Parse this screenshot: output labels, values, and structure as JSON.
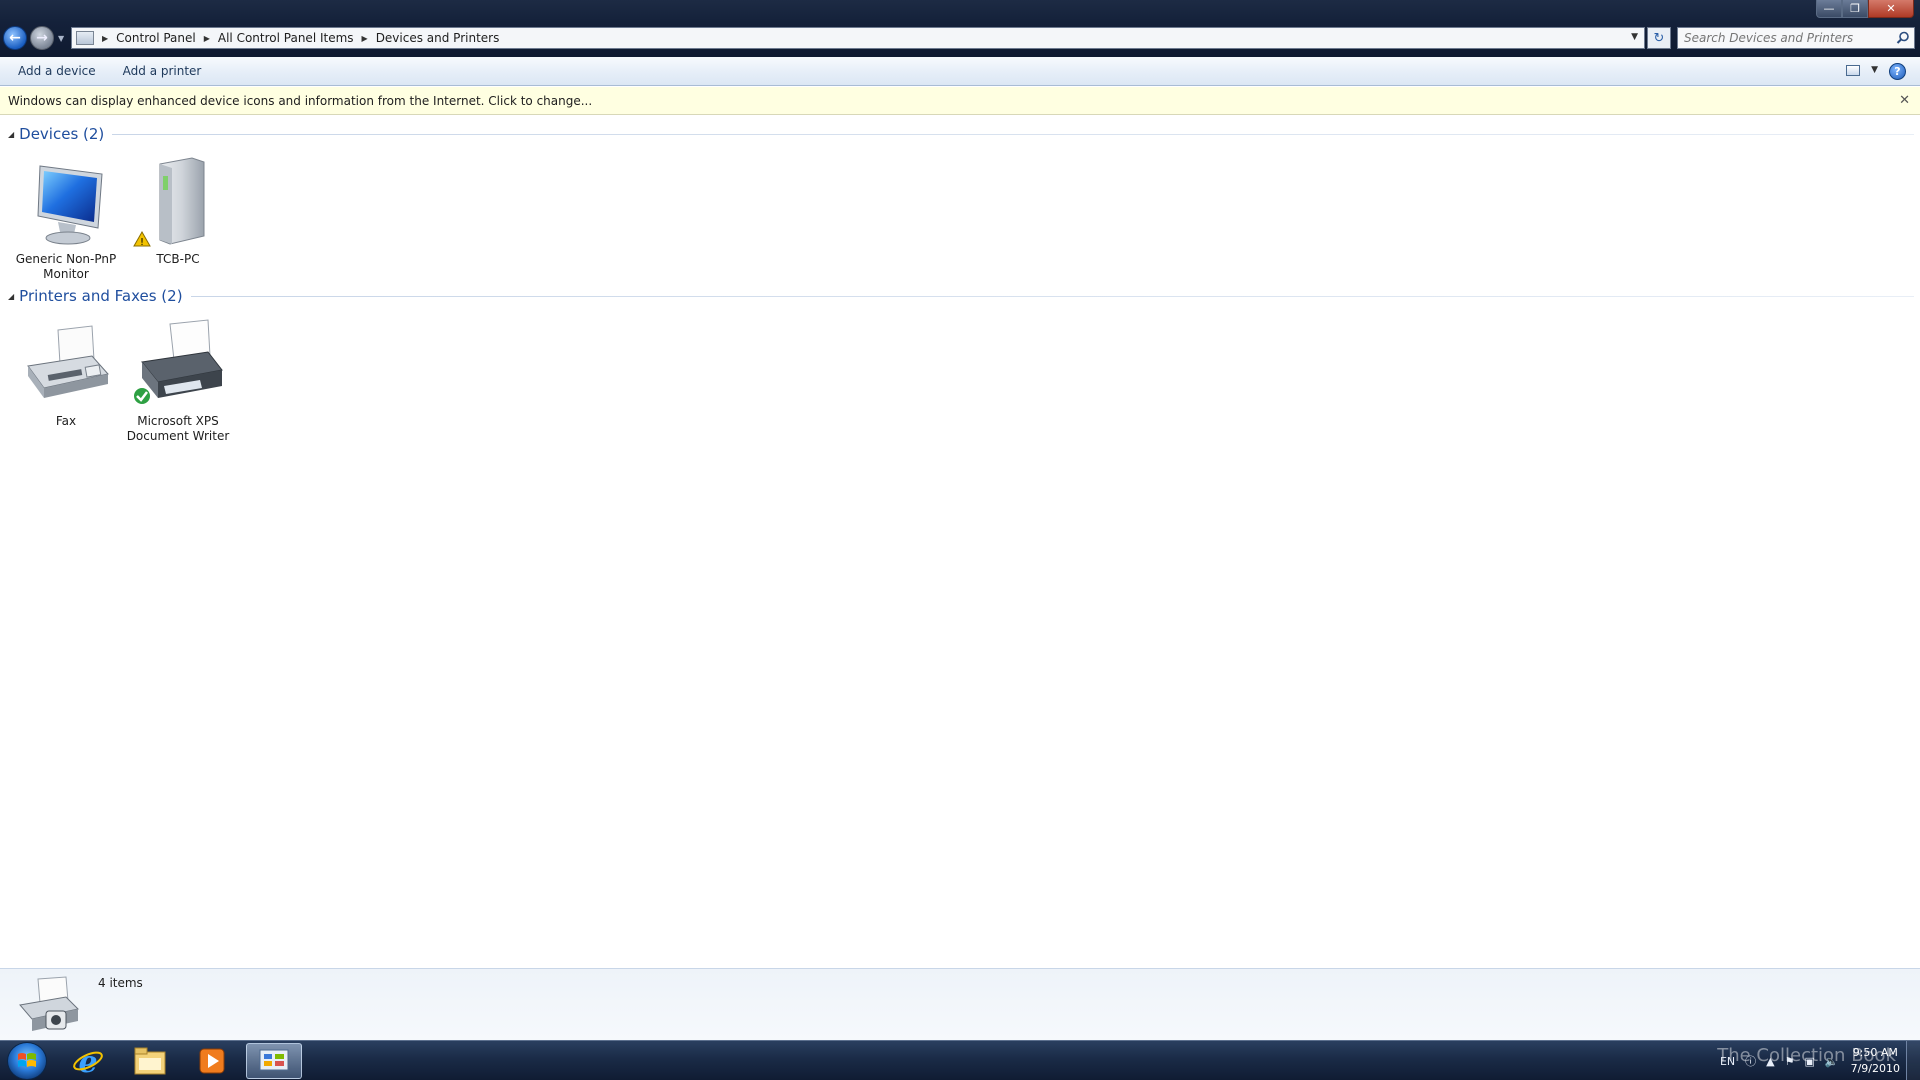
{
  "window": {
    "controls": [
      "minimize",
      "maximize",
      "close"
    ]
  },
  "address": {
    "crumbs": [
      "Control Panel",
      "All Control Panel Items",
      "Devices and Printers"
    ]
  },
  "search": {
    "placeholder": "Search Devices and Printers"
  },
  "toolbar": {
    "add_device_label": "Add a device",
    "add_printer_label": "Add a printer"
  },
  "infobar": {
    "text": "Windows can display enhanced device icons and information from the Internet. Click to change..."
  },
  "groups": [
    {
      "title": "Devices (2)",
      "items": [
        {
          "label_lines": [
            "Generic Non-PnP",
            "Monitor"
          ],
          "icon": "monitor-icon"
        },
        {
          "label_lines": [
            "TCB-PC"
          ],
          "icon": "computer-tower-icon",
          "badge": "warning"
        }
      ]
    },
    {
      "title": "Printers and Faxes (2)",
      "items": [
        {
          "label_lines": [
            "Fax"
          ],
          "icon": "fax-icon"
        },
        {
          "label_lines": [
            "Microsoft XPS",
            "Document Writer"
          ],
          "icon": "printer-icon",
          "badge": "default-check"
        }
      ]
    }
  ],
  "details": {
    "count": "4 items",
    "icon": "devices-printers-icon"
  },
  "taskbar": {
    "items": [
      "internet-explorer-icon",
      "windows-explorer-icon",
      "media-player-icon",
      "control-panel-icon"
    ],
    "language": "EN",
    "time": "9:50 AM",
    "date": "7/9/2010",
    "watermark": "The Collection Book"
  },
  "colors": {
    "accent": "#1f4e9e",
    "infobar_bg": "#ffffe1",
    "taskbar": "#1a2b47"
  }
}
